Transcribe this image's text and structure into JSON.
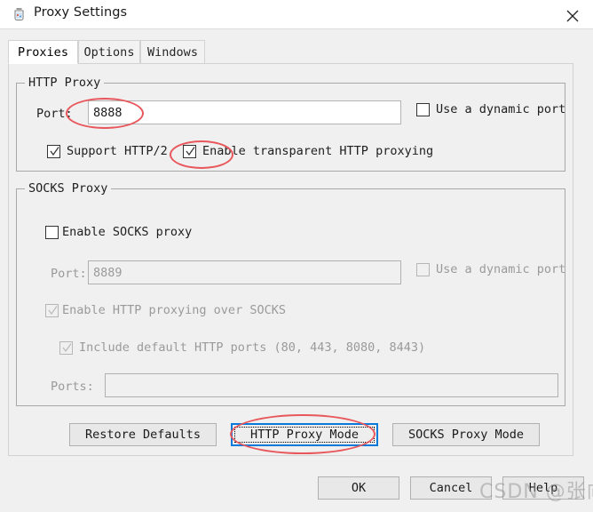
{
  "window": {
    "title": "Proxy Settings",
    "icon": "jar-icon",
    "close_label": "✕"
  },
  "tabs": [
    {
      "label": "Proxies",
      "active": true
    },
    {
      "label": "Options",
      "active": false
    },
    {
      "label": "Windows",
      "active": false
    }
  ],
  "http_proxy": {
    "group_title": "HTTP Proxy",
    "port_label": "Port:",
    "port_value": "8888",
    "port_placeholder": "",
    "dynamic_port_label": "Use a dynamic port",
    "dynamic_port_checked": false,
    "support_http2_label": "Support HTTP/2",
    "support_http2_checked": true,
    "transparent_label": "Enable transparent HTTP proxying",
    "transparent_checked": true
  },
  "socks_proxy": {
    "group_title": "SOCKS Proxy",
    "enable_label": "Enable SOCKS proxy",
    "enable_checked": false,
    "port_label": "Port:",
    "port_value": "8889",
    "dynamic_port_label": "Use a dynamic port",
    "dynamic_port_checked": false,
    "http_over_socks_label": "Enable HTTP proxying over SOCKS",
    "http_over_socks_checked": true,
    "include_default_label": "Include default HTTP ports (80, 443, 8080, 8443)",
    "include_default_checked": true,
    "ports_label": "Ports:",
    "ports_value": ""
  },
  "mode_buttons": {
    "restore_defaults": "Restore Defaults",
    "http_proxy_mode": "HTTP Proxy Mode",
    "socks_proxy_mode": "SOCKS Proxy Mode"
  },
  "dialog_buttons": {
    "ok": "OK",
    "cancel": "Cancel",
    "help": "Help"
  },
  "watermark": {
    "text": "CSDN @张向恒"
  },
  "colors": {
    "annotation": "#e8575b",
    "focus": "#0a7ada",
    "window_bg": "#f0f0f0"
  }
}
